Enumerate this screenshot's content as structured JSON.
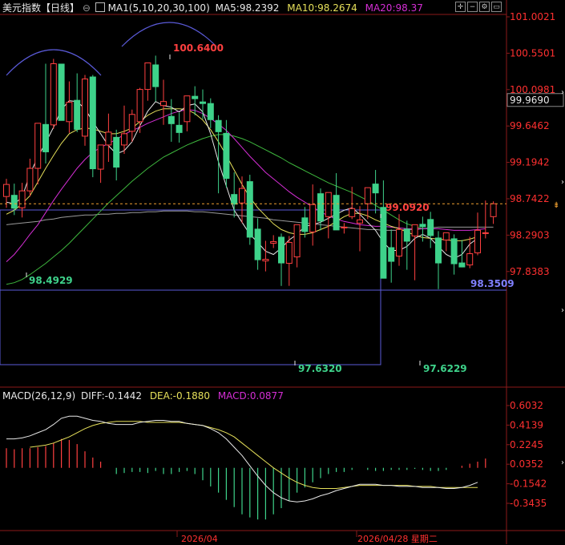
{
  "header": {
    "symbol": "美元指数",
    "period": "【日线】",
    "ma_label": "MA1(5,10,20,30,100)",
    "ma5": "MA5:98.2392",
    "ma10": "MA10:98.2674",
    "ma20": "MA20:98.37"
  },
  "macd_header": {
    "label": "MACD(26,12,9)",
    "diff": "DIFF:-0.1442",
    "dea": "DEA:-0.1880",
    "macd": "MACD:0.0877"
  },
  "toolbar": {
    "icons": [
      "zoom-icon",
      "minus-icon",
      "settings-icon",
      "panel-icon",
      "close-icon"
    ]
  },
  "colors": {
    "up": "#ff4040",
    "down": "#3ed28a",
    "ma5": "#e8e8e8",
    "ma10": "#e6e05a",
    "ma20": "#d52ed5",
    "ma30": "#3eb83e",
    "ma100": "#9a9a9a",
    "axis_text": "#ff3030",
    "current_price": "#f0a030"
  },
  "chart_data": {
    "type": "candlestick",
    "price_axis": {
      "ticks": [
        "101.0021",
        "100.5501",
        "100.0981",
        "99.6462",
        "99.1942",
        "98.7422",
        "98.2903",
        "97.8383"
      ],
      "range": [
        97.5,
        101.15
      ]
    },
    "macd_axis": {
      "ticks": [
        "0.6032",
        "0.4139",
        "0.2245",
        "0.0352",
        "-0.1542",
        "-0.3435"
      ],
      "range": [
        -0.55,
        0.72
      ]
    },
    "current_price": "99.9690",
    "annotations": [
      "100.6400",
      "99.0920",
      "98.4929",
      "97.6320",
      "97.6229",
      "98.3509"
    ],
    "x_labels": [
      "2026/04",
      "2026/04/28 星期二"
    ],
    "candles": [
      [
        98.77,
        98.99,
        98.63,
        98.92
      ],
      [
        98.79,
        98.93,
        98.54,
        98.62
      ],
      [
        98.63,
        98.94,
        98.51,
        98.84
      ],
      [
        98.84,
        99.24,
        98.77,
        99.12
      ],
      [
        99.12,
        99.62,
        98.92,
        99.68
      ],
      [
        99.67,
        100.42,
        99.18,
        99.32
      ],
      [
        99.66,
        100.48,
        99.61,
        100.42
      ],
      [
        100.42,
        100.4,
        99.77,
        99.71
      ],
      [
        99.7,
        100.2,
        99.56,
        99.94
      ],
      [
        99.97,
        100.3,
        99.57,
        99.6
      ],
      [
        99.52,
        100.28,
        99.4,
        100.23
      ],
      [
        100.26,
        100.28,
        99.01,
        99.11
      ],
      [
        99.11,
        99.31,
        98.94,
        99.41
      ],
      [
        99.41,
        99.8,
        99.2,
        99.57
      ],
      [
        99.51,
        99.6,
        98.97,
        99.13
      ],
      [
        99.41,
        99.9,
        99.3,
        99.55
      ],
      [
        99.58,
        99.85,
        99.45,
        99.79
      ],
      [
        99.7,
        100.12,
        99.56,
        100.1
      ],
      [
        100.1,
        100.4,
        99.96,
        100.43
      ],
      [
        100.41,
        100.52,
        99.95,
        100.13
      ],
      [
        99.9,
        100.22,
        99.66,
        99.95
      ],
      [
        99.77,
        99.98,
        99.45,
        99.67
      ],
      [
        99.66,
        99.81,
        99.44,
        99.56
      ],
      [
        99.7,
        100.02,
        99.58,
        100.02
      ],
      [
        100.02,
        100.14,
        99.78,
        99.98
      ],
      [
        99.95,
        100.1,
        99.73,
        99.92
      ],
      [
        99.93,
        99.99,
        99.62,
        99.72
      ],
      [
        99.72,
        99.78,
        98.81,
        99.57
      ],
      [
        99.56,
        99.72,
        98.88,
        98.99
      ],
      [
        98.8,
        99.07,
        98.51,
        98.67
      ],
      [
        98.69,
        99.02,
        98.44,
        98.87
      ],
      [
        98.96,
        99.04,
        98.17,
        98.26
      ],
      [
        98.37,
        98.5,
        97.86,
        97.98
      ],
      [
        97.97,
        98.22,
        97.84,
        97.99
      ],
      [
        98.19,
        98.29,
        98.13,
        98.21
      ],
      [
        98.27,
        98.31,
        97.66,
        97.94
      ],
      [
        97.94,
        98.28,
        97.66,
        98.2
      ],
      [
        98.02,
        98.42,
        97.89,
        98.42
      ],
      [
        98.51,
        98.64,
        98.26,
        98.33
      ],
      [
        98.33,
        98.92,
        98.16,
        98.67
      ],
      [
        98.81,
        98.87,
        98.35,
        98.46
      ],
      [
        98.52,
        98.8,
        98.25,
        98.82
      ],
      [
        98.79,
        99.06,
        98.49,
        98.35
      ],
      [
        98.38,
        98.44,
        98.31,
        98.39
      ],
      [
        98.52,
        98.89,
        98.49,
        98.62
      ],
      [
        98.44,
        98.65,
        98.09,
        98.48
      ],
      [
        98.68,
        98.88,
        98.49,
        98.88
      ],
      [
        98.93,
        99.1,
        98.56,
        98.81
      ],
      [
        98.64,
        98.97,
        97.99,
        97.75
      ],
      [
        98.14,
        98.36,
        97.7,
        97.96
      ],
      [
        98.03,
        98.55,
        97.91,
        98.36
      ],
      [
        98.37,
        98.47,
        97.86,
        98.21
      ],
      [
        98.28,
        98.36,
        97.73,
        98.42
      ],
      [
        98.43,
        98.52,
        98.21,
        98.39
      ],
      [
        98.49,
        98.58,
        98.13,
        98.28
      ],
      [
        98.26,
        98.34,
        97.62,
        97.94
      ],
      [
        98.23,
        98.3,
        98.09,
        98.32
      ],
      [
        98.25,
        98.3,
        97.8,
        97.93
      ],
      [
        97.95,
        98.23,
        97.89,
        97.89
      ],
      [
        97.92,
        98.27,
        97.88,
        98.06
      ],
      [
        98.07,
        98.57,
        98.04,
        98.35
      ],
      [
        98.32,
        98.72,
        98.25,
        98.32
      ],
      [
        98.52,
        98.71,
        98.43,
        98.68
      ]
    ],
    "ma5": [
      98.7,
      98.68,
      98.76,
      99.05,
      99.26,
      99.44,
      99.63,
      99.85,
      99.96,
      99.95,
      99.86,
      99.7,
      99.55,
      99.4,
      99.3,
      99.34,
      99.45,
      99.65,
      99.83,
      99.95,
      99.9,
      99.88,
      99.82,
      99.9,
      99.92,
      99.82,
      99.55,
      99.2,
      98.9,
      98.6,
      98.45,
      98.3,
      98.2,
      98.09,
      98.05,
      98.13,
      98.23,
      98.3,
      98.4,
      98.42,
      98.45,
      98.5,
      98.55,
      98.6,
      98.63,
      98.55,
      98.45,
      98.35,
      98.2,
      98.1,
      98.1,
      98.15,
      98.25,
      98.3,
      98.25,
      98.15,
      98.05,
      98.0,
      98.05,
      98.18,
      98.25
    ],
    "ma10": [
      98.55,
      98.6,
      98.68,
      98.78,
      98.95,
      99.12,
      99.28,
      99.43,
      99.55,
      99.6,
      99.62,
      99.61,
      99.58,
      99.55,
      99.55,
      99.58,
      99.62,
      99.7,
      99.78,
      99.83,
      99.86,
      99.86,
      99.86,
      99.85,
      99.8,
      99.72,
      99.6,
      99.45,
      99.28,
      99.1,
      98.92,
      98.76,
      98.63,
      98.53,
      98.43,
      98.36,
      98.32,
      98.3,
      98.3,
      98.32,
      98.36,
      98.4,
      98.46,
      98.52,
      98.56,
      98.56,
      98.53,
      98.48,
      98.44,
      98.4,
      98.37,
      98.33,
      98.29,
      98.26,
      98.25,
      98.24,
      98.23,
      98.22,
      98.22,
      98.24,
      98.27
    ],
    "ma20": [
      97.96,
      98.05,
      98.17,
      98.3,
      98.42,
      98.57,
      98.72,
      98.86,
      98.99,
      99.12,
      99.23,
      99.32,
      99.38,
      99.43,
      99.48,
      99.54,
      99.59,
      99.63,
      99.68,
      99.72,
      99.76,
      99.8,
      99.83,
      99.85,
      99.84,
      99.8,
      99.74,
      99.67,
      99.59,
      99.49,
      99.38,
      99.27,
      99.17,
      99.07,
      98.99,
      98.91,
      98.83,
      98.76,
      98.7,
      98.64,
      98.58,
      98.53,
      98.49,
      98.46,
      98.44,
      98.42,
      98.41,
      98.4,
      98.4,
      98.39,
      98.38,
      98.37,
      98.37,
      98.37,
      98.37,
      98.37,
      98.36,
      98.35,
      98.35,
      98.35,
      98.36,
      98.37
    ],
    "ma30": [
      97.68,
      97.7,
      97.74,
      97.8,
      97.87,
      97.94,
      98.02,
      98.1,
      98.19,
      98.29,
      98.39,
      98.49,
      98.59,
      98.69,
      98.78,
      98.87,
      98.96,
      99.04,
      99.12,
      99.19,
      99.26,
      99.31,
      99.36,
      99.41,
      99.45,
      99.49,
      99.52,
      99.54,
      99.54,
      99.52,
      99.49,
      99.45,
      99.4,
      99.35,
      99.3,
      99.25,
      99.19,
      99.14,
      99.09,
      99.04,
      98.99,
      98.94,
      98.9,
      98.86,
      98.82,
      98.77,
      98.72,
      98.66,
      98.6,
      98.54,
      98.48,
      98.43,
      98.4,
      98.37
    ],
    "ma100": [
      98.42,
      98.43,
      98.44,
      98.45,
      98.46,
      98.48,
      98.49,
      98.51,
      98.52,
      98.53,
      98.54,
      98.54,
      98.55,
      98.55,
      98.56,
      98.56,
      98.57,
      98.57,
      98.58,
      98.58,
      98.59,
      98.59,
      98.59,
      98.59,
      98.58,
      98.58,
      98.57,
      98.56,
      98.55,
      98.54,
      98.53,
      98.52,
      98.51,
      98.5,
      98.48,
      98.47,
      98.46,
      98.45,
      98.44,
      98.43,
      98.42,
      98.41,
      98.4,
      98.39,
      98.38,
      98.37,
      98.36,
      98.36,
      98.35,
      98.35,
      98.35,
      98.36,
      98.36,
      98.37,
      98.38,
      98.39,
      98.39,
      98.39,
      98.39,
      98.39,
      98.39,
      98.39,
      98.39
    ],
    "macd_diff": [
      0.28,
      0.28,
      0.29,
      0.31,
      0.34,
      0.37,
      0.42,
      0.48,
      0.5,
      0.5,
      0.48,
      0.46,
      0.45,
      0.43,
      0.42,
      0.42,
      0.42,
      0.44,
      0.45,
      0.46,
      0.46,
      0.45,
      0.45,
      0.43,
      0.42,
      0.41,
      0.38,
      0.34,
      0.28,
      0.2,
      0.12,
      0.02,
      -0.08,
      -0.17,
      -0.24,
      -0.29,
      -0.32,
      -0.33,
      -0.32,
      -0.3,
      -0.27,
      -0.25,
      -0.22,
      -0.2,
      -0.18,
      -0.16,
      -0.16,
      -0.16,
      -0.17,
      -0.17,
      -0.18,
      -0.18,
      -0.18,
      -0.19,
      -0.19,
      -0.19,
      -0.2,
      -0.2,
      -0.19,
      -0.17,
      -0.14
    ],
    "macd_dea": [
      0.2,
      0.21,
      0.22,
      0.24,
      0.27,
      0.3,
      0.34,
      0.38,
      0.41,
      0.43,
      0.44,
      0.45,
      0.45,
      0.45,
      0.45,
      0.44,
      0.44,
      0.44,
      0.44,
      0.44,
      0.43,
      0.42,
      0.41,
      0.39,
      0.37,
      0.34,
      0.3,
      0.24,
      0.18,
      0.12,
      0.06,
      0.0,
      -0.05,
      -0.1,
      -0.14,
      -0.17,
      -0.19,
      -0.2,
      -0.2,
      -0.2,
      -0.19,
      -0.18,
      -0.17,
      -0.17,
      -0.17,
      -0.17,
      -0.17,
      -0.17,
      -0.17,
      -0.18,
      -0.18,
      -0.18,
      -0.19,
      -0.19,
      -0.19,
      -0.19,
      -0.19,
      -0.19
    ],
    "macd_hist": [
      0.19,
      0.18,
      0.19,
      0.19,
      0.2,
      0.21,
      0.24,
      0.28,
      0.27,
      0.23,
      0.16,
      0.1,
      0.06,
      0.0,
      -0.06,
      -0.05,
      -0.04,
      -0.04,
      -0.05,
      -0.03,
      -0.06,
      -0.06,
      -0.04,
      -0.03,
      -0.06,
      -0.12,
      -0.18,
      -0.24,
      -0.31,
      -0.38,
      -0.45,
      -0.48,
      -0.5,
      -0.5,
      -0.45,
      -0.39,
      -0.32,
      -0.24,
      -0.19,
      -0.14,
      -0.1,
      -0.06,
      -0.04,
      -0.04,
      -0.02,
      0.0,
      -0.02,
      -0.03,
      -0.03,
      -0.02,
      -0.02,
      -0.02,
      -0.01,
      -0.02,
      -0.03,
      -0.03,
      -0.02,
      0.0,
      0.02,
      0.04,
      0.06,
      0.09
    ]
  }
}
